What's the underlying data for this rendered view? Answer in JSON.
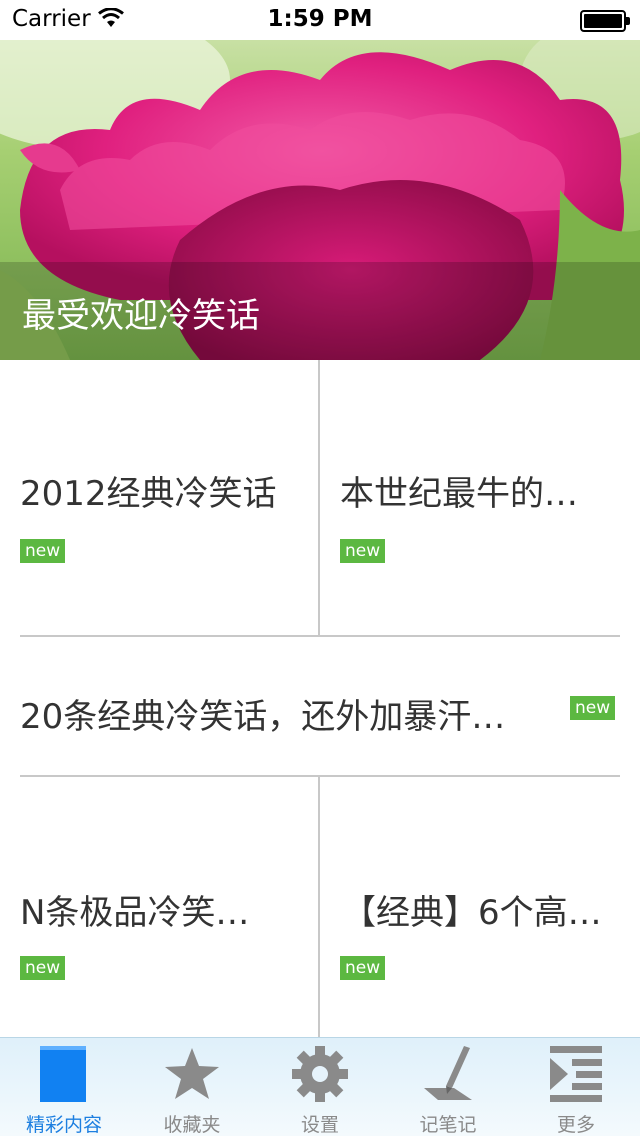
{
  "status_bar": {
    "carrier": "Carrier",
    "time": "1:59 PM"
  },
  "banner": {
    "caption": "最受欢迎冷笑话"
  },
  "cards": [
    {
      "title": "2012经典冷笑话",
      "badge": "new"
    },
    {
      "title": "本世纪最牛的…",
      "badge": "new"
    },
    {
      "title": "20条经典冷笑话，还外加暴汗…",
      "badge": "new"
    },
    {
      "title": "N条极品冷笑…",
      "badge": "new"
    },
    {
      "title": "【经典】6个高…",
      "badge": "new"
    }
  ],
  "tab_bar": {
    "tabs": [
      {
        "label": "精彩内容",
        "icon": "content-icon",
        "active": true
      },
      {
        "label": "收藏夹",
        "icon": "star-icon",
        "active": false
      },
      {
        "label": "设置",
        "icon": "gear-icon",
        "active": false
      },
      {
        "label": "记笔记",
        "icon": "note-icon",
        "active": false
      },
      {
        "label": "更多",
        "icon": "more-icon",
        "active": false
      }
    ]
  },
  "colors": {
    "badge": "#5cb841",
    "active_tab": "#1d7fe0",
    "inactive_tab": "#8a8a8a"
  }
}
